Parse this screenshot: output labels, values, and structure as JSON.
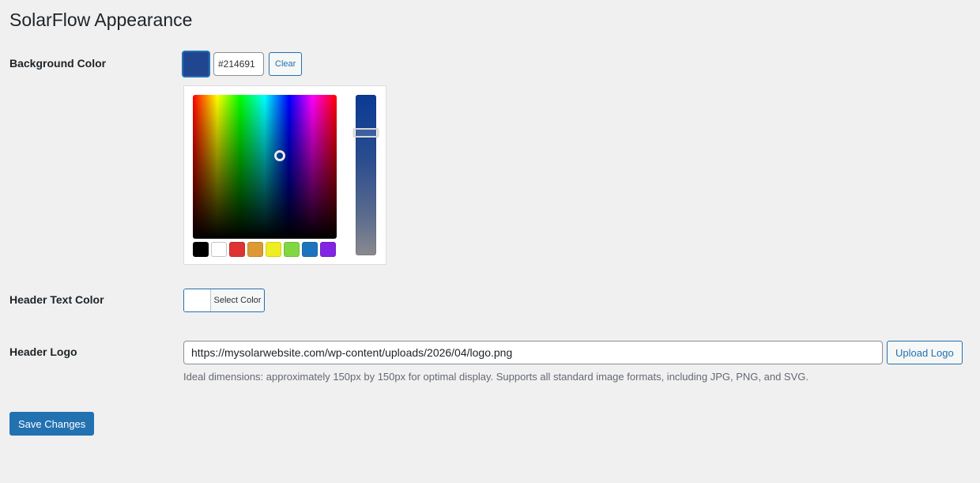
{
  "page": {
    "title": "SolarFlow Appearance"
  },
  "background_color": {
    "label": "Background Color",
    "value": "#214691",
    "clear_label": "Clear",
    "palette": [
      "#000000",
      "#ffffff",
      "#dd3333",
      "#dd9933",
      "#eeee22",
      "#81d742",
      "#1e73be",
      "#8224e3"
    ]
  },
  "header_text_color": {
    "label": "Header Text Color",
    "button_label": "Select Color",
    "value": "#ffffff"
  },
  "header_logo": {
    "label": "Header Logo",
    "value": "https://mysolarwebsite.com/wp-content/uploads/2026/04/logo.png",
    "upload_label": "Upload Logo",
    "description": "Ideal dimensions: approximately 150px by 150px for optimal display. Supports all standard image formats, including JPG, PNG, and SVG."
  },
  "actions": {
    "save_label": "Save Changes"
  },
  "colors": {
    "accent": "#2271b1",
    "page_bg": "#f0f0f1"
  }
}
